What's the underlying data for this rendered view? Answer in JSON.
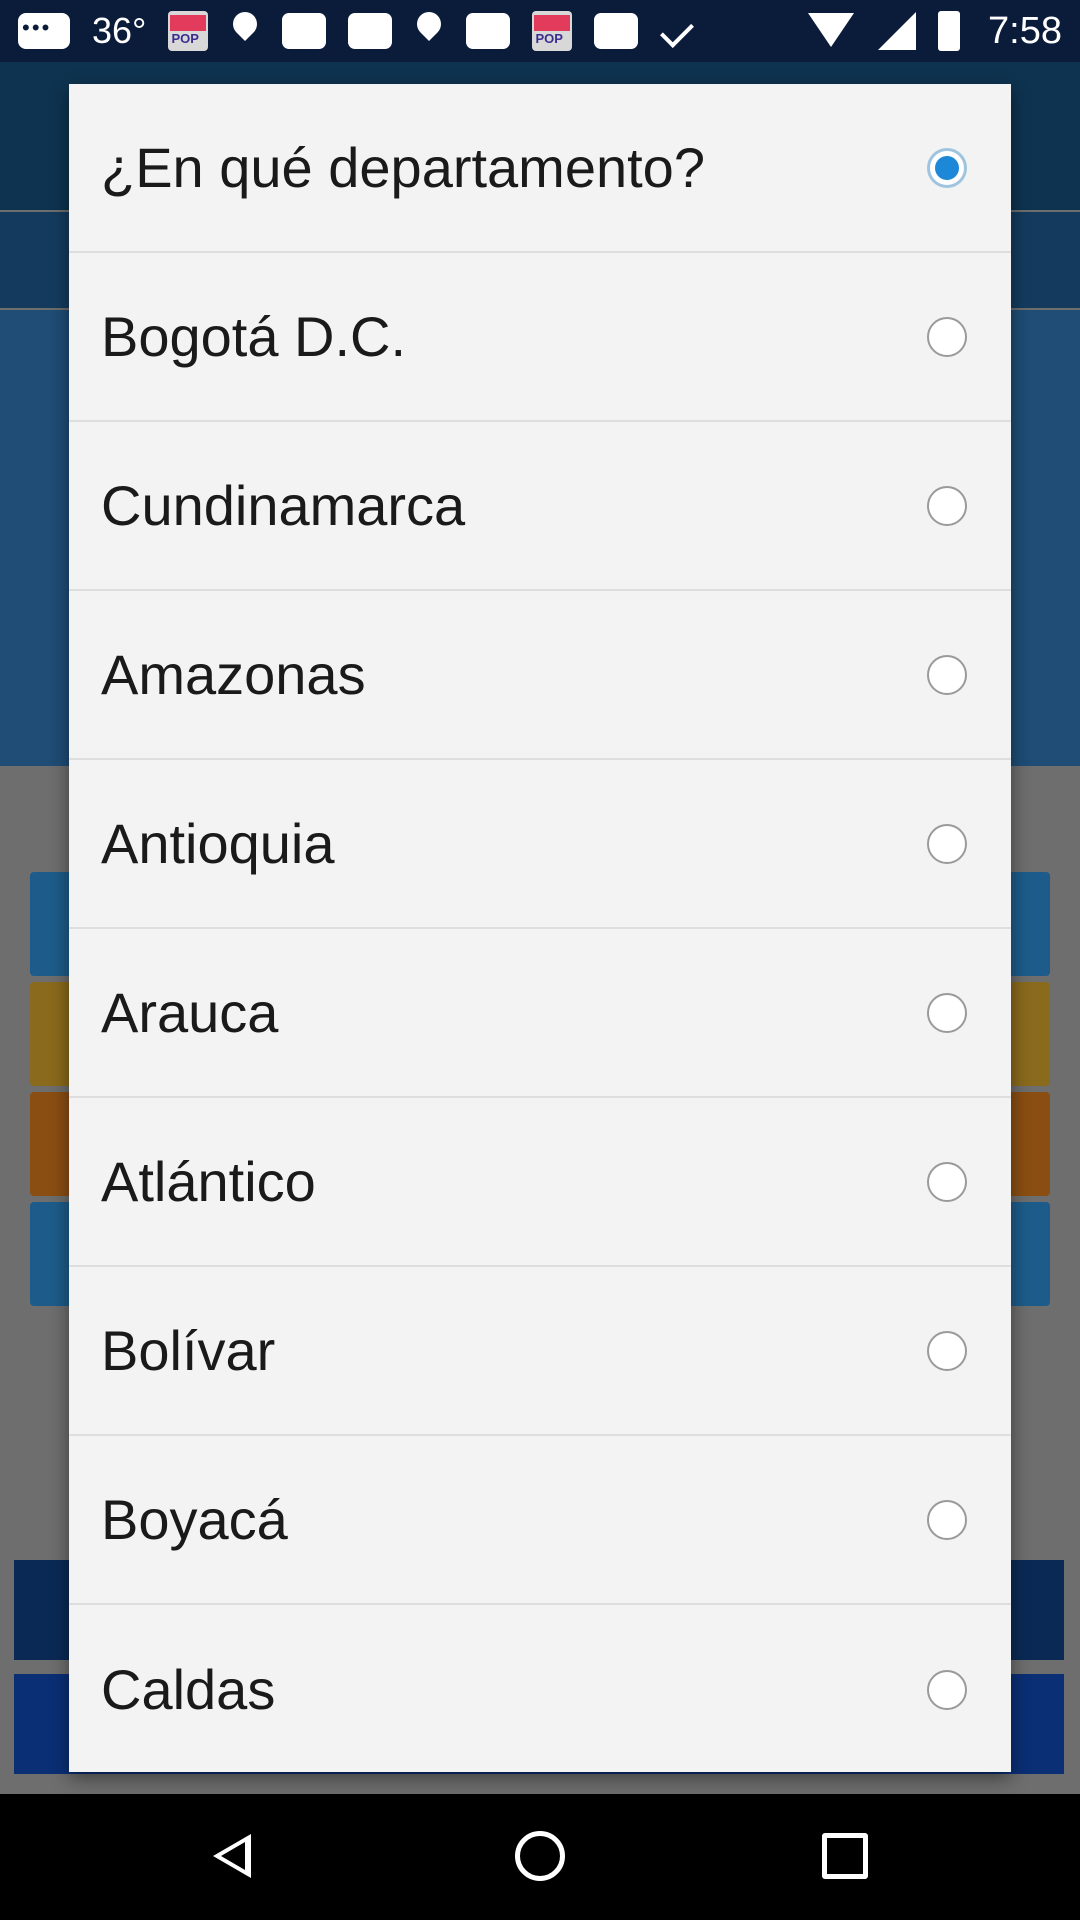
{
  "status_bar": {
    "left_text": "36°",
    "time": "7:58",
    "icons": [
      "message-icon",
      "pop-app-icon",
      "location-pin-icon",
      "card-icon",
      "location-pin-icon",
      "card-icon",
      "pop-app-icon",
      "card-icon",
      "check-icon",
      "wifi-icon",
      "signal-icon",
      "battery-icon"
    ]
  },
  "dialog": {
    "options": [
      {
        "label": "¿En qué departamento?",
        "checked": true
      },
      {
        "label": "Bogotá D.C.",
        "checked": false
      },
      {
        "label": "Cundinamarca",
        "checked": false
      },
      {
        "label": "Amazonas",
        "checked": false
      },
      {
        "label": "Antioquia",
        "checked": false
      },
      {
        "label": "Arauca",
        "checked": false
      },
      {
        "label": "Atlántico",
        "checked": false
      },
      {
        "label": "Bolívar",
        "checked": false
      },
      {
        "label": "Boyacá",
        "checked": false
      },
      {
        "label": "Caldas",
        "checked": false
      }
    ],
    "accent_color": "#1e88d8"
  },
  "nav_bar": {
    "icons": [
      "back-icon",
      "home-icon",
      "recent-apps-icon"
    ]
  }
}
